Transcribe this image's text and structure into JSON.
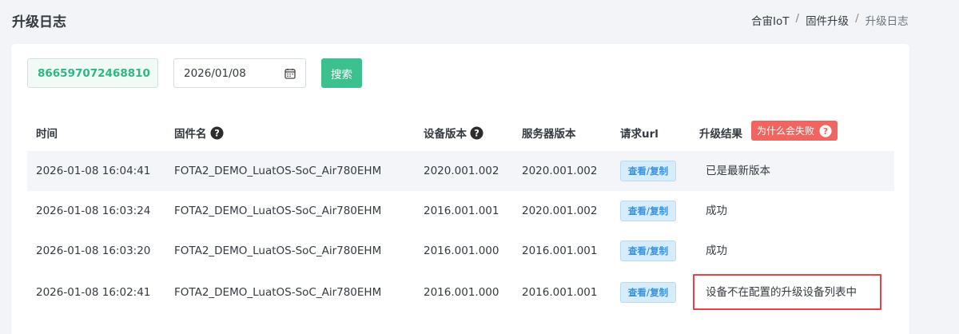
{
  "header": {
    "title": "升级日志",
    "breadcrumb": [
      "合宙IoT",
      "固件升级",
      "升级日志"
    ]
  },
  "filters": {
    "imei": "866597072468810",
    "date": "2026/01/08",
    "search_label": "搜索"
  },
  "table": {
    "headers": {
      "time": "时间",
      "firmware": "固件名",
      "device_version": "设备版本",
      "server_version": "服务器版本",
      "url": "请求url",
      "result": "升级结果"
    },
    "why_fail_label": "为什么会失败",
    "rows": [
      {
        "time": "2026-01-08 16:04:41",
        "firmware": "FOTA2_DEMO_LuatOS-SoC_Air780EHM",
        "device_version": "2020.001.002",
        "server_version": "2020.001.002",
        "url_label": "查看/复制",
        "result": "已是最新版本"
      },
      {
        "time": "2026-01-08 16:03:24",
        "firmware": "FOTA2_DEMO_LuatOS-SoC_Air780EHM",
        "device_version": "2016.001.001",
        "server_version": "2020.001.002",
        "url_label": "查看/复制",
        "result": "成功"
      },
      {
        "time": "2026-01-08 16:03:20",
        "firmware": "FOTA2_DEMO_LuatOS-SoC_Air780EHM",
        "device_version": "2016.001.000",
        "server_version": "2016.001.001",
        "url_label": "查看/复制",
        "result": "成功"
      },
      {
        "time": "2026-01-08 16:02:41",
        "firmware": "FOTA2_DEMO_LuatOS-SoC_Air780EHM",
        "device_version": "2016.001.000",
        "server_version": "2016.001.001",
        "url_label": "查看/复制",
        "result": "设备不在配置的升级设备列表中"
      }
    ]
  },
  "colors": {
    "accent_green": "#3cc08d",
    "danger_red": "#f0655f",
    "link_blue": "#3b92df"
  },
  "icons": [
    "calendar-icon",
    "help-circle-icon"
  ]
}
